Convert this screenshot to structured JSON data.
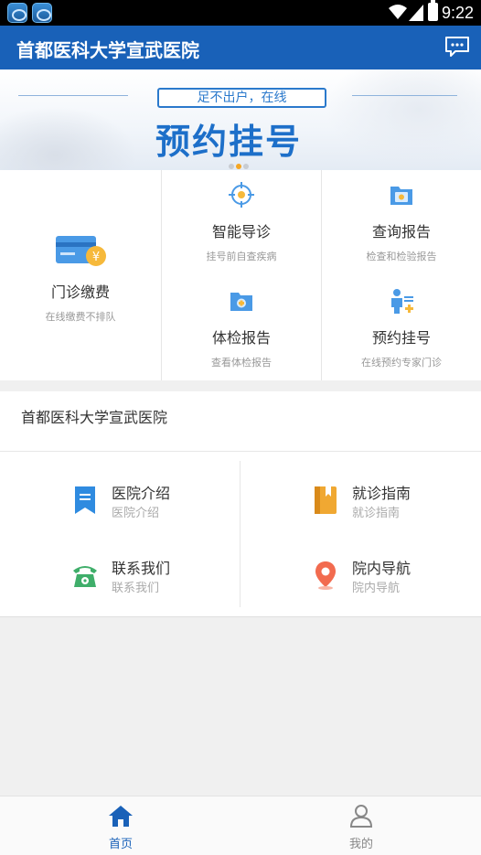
{
  "status_bar": {
    "time": "9:22"
  },
  "header": {
    "title": "首都医科大学宣武医院",
    "message_icon": "chat-bubble-icon"
  },
  "banner": {
    "subtitle": "足不出户，在线",
    "headline": "预约挂号"
  },
  "services": [
    {
      "title": "门诊缴费",
      "subtitle": "在线缴费不排队",
      "icon": "card-payment-icon"
    },
    {
      "title": "智能导诊",
      "subtitle": "挂号前自查疾病",
      "icon": "target-icon"
    },
    {
      "title": "查询报告",
      "subtitle": "检查和检验报告",
      "icon": "report-folder-icon"
    },
    {
      "title": "体检报告",
      "subtitle": "查看体检报告",
      "icon": "medical-folder-icon"
    },
    {
      "title": "预约挂号",
      "subtitle": "在线预约专家门诊",
      "icon": "doctor-appointment-icon"
    }
  ],
  "hospital_section": {
    "title": "首都医科大学宣武医院"
  },
  "links": [
    {
      "title": "医院介绍",
      "subtitle": "医院介绍",
      "icon": "bookmark-icon",
      "color": "#2f8be0"
    },
    {
      "title": "就诊指南",
      "subtitle": "就诊指南",
      "icon": "guide-book-icon",
      "color": "#f0a832"
    },
    {
      "title": "联系我们",
      "subtitle": "联系我们",
      "icon": "telephone-icon",
      "color": "#3fae6a"
    },
    {
      "title": "院内导航",
      "subtitle": "院内导航",
      "icon": "location-pin-icon",
      "color": "#f26b4f"
    }
  ],
  "tabbar": {
    "home": "首页",
    "mine": "我的"
  },
  "colors": {
    "primary": "#1961b8",
    "background": "#f0f0f0"
  }
}
